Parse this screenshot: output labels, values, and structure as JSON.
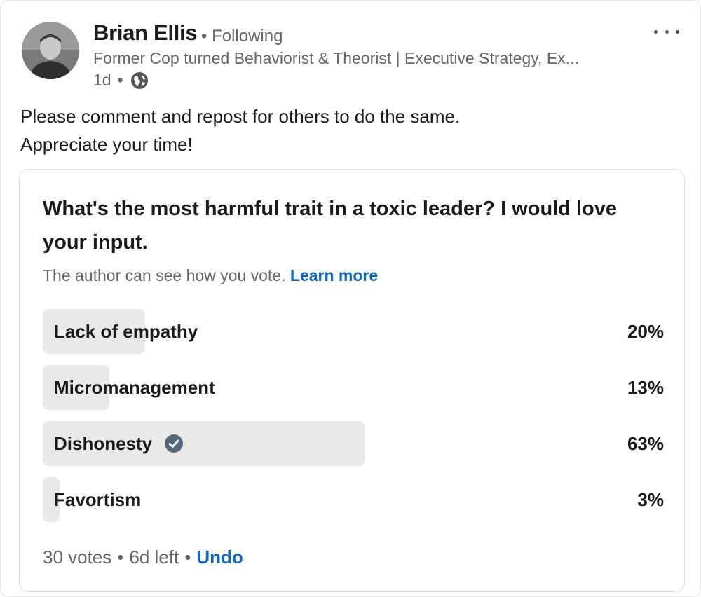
{
  "post": {
    "author": {
      "name": "Brian Ellis",
      "follow_status": "Following",
      "headline": "Former Cop turned Behaviorist & Theorist | Executive Strategy, Ex...",
      "time_ago": "1d",
      "visibility_icon": "globe-icon"
    },
    "more_icon": "more-horizontal-icon",
    "text_lines": [
      "Please comment and repost for others to do the same.",
      "Appreciate your time!"
    ]
  },
  "poll": {
    "question": "What's the most harmful trait in a toxic leader? I would love your input.",
    "visibility_note": "The author can see how you vote.",
    "learn_more": "Learn more",
    "options": [
      {
        "label": "Lack of empathy",
        "percent": "20%",
        "share": 0.2,
        "selected": false
      },
      {
        "label": "Micromanagement",
        "percent": "13%",
        "share": 0.13,
        "selected": false
      },
      {
        "label": "Dishonesty",
        "percent": "63%",
        "share": 0.63,
        "selected": true
      },
      {
        "label": "Favortism",
        "percent": "3%",
        "share": 0.03,
        "selected": false
      }
    ],
    "votes": "30 votes",
    "time_left": "6d left",
    "undo": "Undo"
  },
  "colors": {
    "link": "#0a66c2",
    "bar": "#e9e9e9",
    "muted_text": "#666666",
    "check_badge": "#56687a"
  }
}
